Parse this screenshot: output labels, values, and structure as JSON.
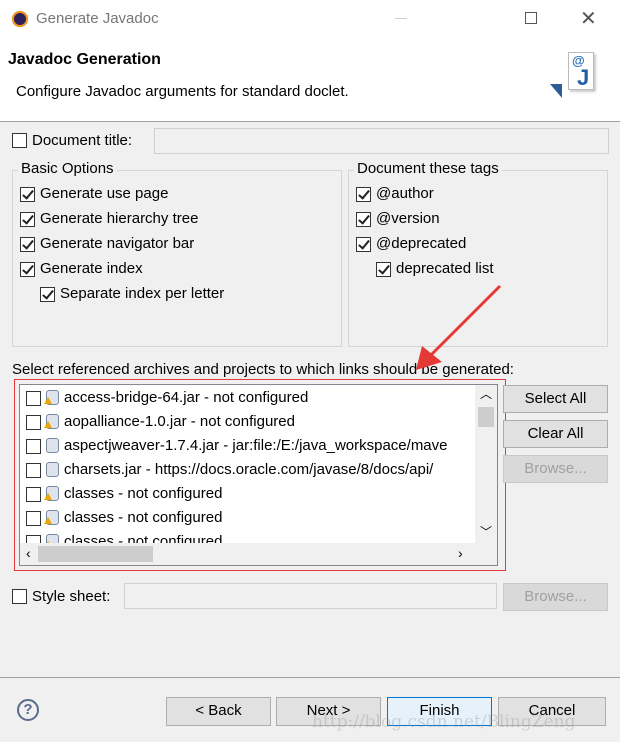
{
  "window": {
    "title": "Generate Javadoc"
  },
  "header": {
    "title": "Javadoc Generation",
    "description": "Configure Javadoc arguments for standard doclet."
  },
  "document_title": {
    "label": "Document title:",
    "checked": false,
    "value": ""
  },
  "basic_options": {
    "label": "Basic Options",
    "items": [
      {
        "label": "Generate use page",
        "checked": true
      },
      {
        "label": "Generate hierarchy tree",
        "checked": true
      },
      {
        "label": "Generate navigator bar",
        "checked": true
      },
      {
        "label": "Generate index",
        "checked": true
      },
      {
        "label": "Separate index per letter",
        "checked": true
      }
    ]
  },
  "tags": {
    "label": "Document these tags",
    "items": [
      {
        "label": "@author",
        "checked": true
      },
      {
        "label": "@version",
        "checked": true
      },
      {
        "label": "@deprecated",
        "checked": true
      },
      {
        "label": "deprecated list",
        "checked": true
      }
    ]
  },
  "archives": {
    "label": "Select referenced archives and projects to which links should be generated:",
    "items": [
      {
        "label": "access-bridge-64.jar - not configured",
        "warning": true
      },
      {
        "label": "aopalliance-1.0.jar - not configured",
        "warning": true
      },
      {
        "label": "aspectjweaver-1.7.4.jar - jar:file:/E:/java_workspace/mave",
        "warning": false
      },
      {
        "label": "charsets.jar - https://docs.oracle.com/javase/8/docs/api/",
        "warning": false
      },
      {
        "label": "classes - not configured",
        "warning": true
      },
      {
        "label": "classes - not configured",
        "warning": true
      },
      {
        "label": "classes - not configured",
        "warning": true
      }
    ],
    "select_all": "Select All",
    "clear_all": "Clear All",
    "browse": "Browse..."
  },
  "style_sheet": {
    "label": "Style sheet:",
    "checked": false,
    "value": "",
    "browse": "Browse..."
  },
  "footer": {
    "back": "< Back",
    "next": "Next >",
    "finish": "Finish",
    "cancel": "Cancel"
  },
  "watermark": "http://blog.csdn.net/BlingZeng",
  "colors": {
    "highlight": "#e53935",
    "default_button_border": "#0078d7"
  }
}
